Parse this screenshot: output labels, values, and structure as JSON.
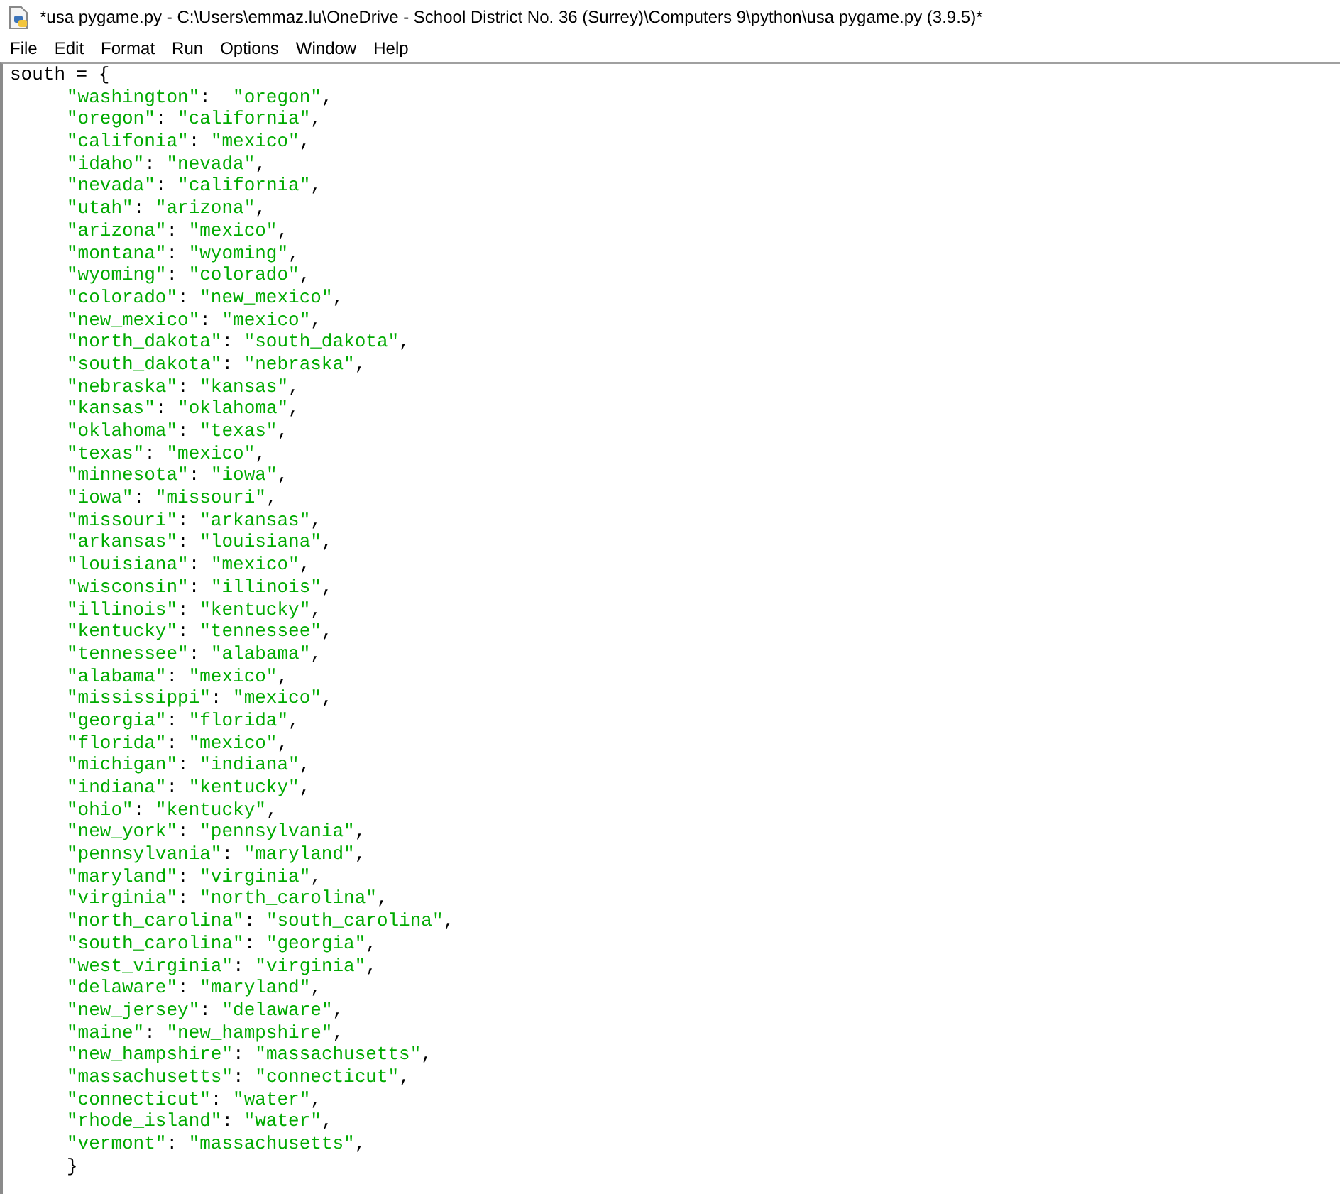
{
  "window": {
    "title": "*usa pygame.py - C:\\Users\\emmaz.lu\\OneDrive - School District No. 36 (Surrey)\\Computers 9\\python\\usa pygame.py (3.9.5)*"
  },
  "menu": [
    "File",
    "Edit",
    "Format",
    "Run",
    "Options",
    "Window",
    "Help"
  ],
  "editor": {
    "lines": [
      {
        "kind": "top",
        "segs": [
          {
            "t": "south = {",
            "kind": "plain"
          }
        ]
      },
      {
        "kind": "entry",
        "segs": [
          {
            "t": "\"washington\"",
            "kind": "string"
          },
          {
            "t": ":  ",
            "kind": "plain"
          },
          {
            "t": "\"oregon\"",
            "kind": "string"
          },
          {
            "t": ",",
            "kind": "plain"
          }
        ]
      },
      {
        "kind": "entry",
        "segs": [
          {
            "t": "\"oregon\"",
            "kind": "string"
          },
          {
            "t": ": ",
            "kind": "plain"
          },
          {
            "t": "\"california\"",
            "kind": "string"
          },
          {
            "t": ",",
            "kind": "plain"
          }
        ]
      },
      {
        "kind": "entry",
        "segs": [
          {
            "t": "\"califonia\"",
            "kind": "string"
          },
          {
            "t": ": ",
            "kind": "plain"
          },
          {
            "t": "\"mexico\"",
            "kind": "string"
          },
          {
            "t": ",",
            "kind": "plain"
          }
        ]
      },
      {
        "kind": "entry",
        "segs": [
          {
            "t": "\"idaho\"",
            "kind": "string"
          },
          {
            "t": ": ",
            "kind": "plain"
          },
          {
            "t": "\"nevada\"",
            "kind": "string"
          },
          {
            "t": ",",
            "kind": "plain"
          }
        ]
      },
      {
        "kind": "entry",
        "segs": [
          {
            "t": "\"nevada\"",
            "kind": "string"
          },
          {
            "t": ": ",
            "kind": "plain"
          },
          {
            "t": "\"california\"",
            "kind": "string"
          },
          {
            "t": ",",
            "kind": "plain"
          }
        ]
      },
      {
        "kind": "entry",
        "segs": [
          {
            "t": "\"utah\"",
            "kind": "string"
          },
          {
            "t": ": ",
            "kind": "plain"
          },
          {
            "t": "\"arizona\"",
            "kind": "string"
          },
          {
            "t": ",",
            "kind": "plain"
          }
        ]
      },
      {
        "kind": "entry",
        "segs": [
          {
            "t": "\"arizona\"",
            "kind": "string"
          },
          {
            "t": ": ",
            "kind": "plain"
          },
          {
            "t": "\"mexico\"",
            "kind": "string"
          },
          {
            "t": ",",
            "kind": "plain"
          }
        ]
      },
      {
        "kind": "entry",
        "segs": [
          {
            "t": "\"montana\"",
            "kind": "string"
          },
          {
            "t": ": ",
            "kind": "plain"
          },
          {
            "t": "\"wyoming\"",
            "kind": "string"
          },
          {
            "t": ",",
            "kind": "plain"
          }
        ]
      },
      {
        "kind": "entry",
        "segs": [
          {
            "t": "\"wyoming\"",
            "kind": "string"
          },
          {
            "t": ": ",
            "kind": "plain"
          },
          {
            "t": "\"colorado\"",
            "kind": "string"
          },
          {
            "t": ",",
            "kind": "plain"
          }
        ]
      },
      {
        "kind": "entry",
        "segs": [
          {
            "t": "\"colorado\"",
            "kind": "string"
          },
          {
            "t": ": ",
            "kind": "plain"
          },
          {
            "t": "\"new_mexico\"",
            "kind": "string"
          },
          {
            "t": ",",
            "kind": "plain"
          }
        ]
      },
      {
        "kind": "entry",
        "segs": [
          {
            "t": "\"new_mexico\"",
            "kind": "string"
          },
          {
            "t": ": ",
            "kind": "plain"
          },
          {
            "t": "\"mexico\"",
            "kind": "string"
          },
          {
            "t": ",",
            "kind": "plain"
          }
        ]
      },
      {
        "kind": "entry",
        "segs": [
          {
            "t": "\"north_dakota\"",
            "kind": "string"
          },
          {
            "t": ": ",
            "kind": "plain"
          },
          {
            "t": "\"south_dakota\"",
            "kind": "string"
          },
          {
            "t": ",",
            "kind": "plain"
          }
        ]
      },
      {
        "kind": "entry",
        "segs": [
          {
            "t": "\"south_dakota\"",
            "kind": "string"
          },
          {
            "t": ": ",
            "kind": "plain"
          },
          {
            "t": "\"nebraska\"",
            "kind": "string"
          },
          {
            "t": ",",
            "kind": "plain"
          }
        ]
      },
      {
        "kind": "entry",
        "segs": [
          {
            "t": "\"nebraska\"",
            "kind": "string"
          },
          {
            "t": ": ",
            "kind": "plain"
          },
          {
            "t": "\"kansas\"",
            "kind": "string"
          },
          {
            "t": ",",
            "kind": "plain"
          }
        ]
      },
      {
        "kind": "entry",
        "segs": [
          {
            "t": "\"kansas\"",
            "kind": "string"
          },
          {
            "t": ": ",
            "kind": "plain"
          },
          {
            "t": "\"oklahoma\"",
            "kind": "string"
          },
          {
            "t": ",",
            "kind": "plain"
          }
        ]
      },
      {
        "kind": "entry",
        "segs": [
          {
            "t": "\"oklahoma\"",
            "kind": "string"
          },
          {
            "t": ": ",
            "kind": "plain"
          },
          {
            "t": "\"texas\"",
            "kind": "string"
          },
          {
            "t": ",",
            "kind": "plain"
          }
        ]
      },
      {
        "kind": "entry",
        "segs": [
          {
            "t": "\"texas\"",
            "kind": "string"
          },
          {
            "t": ": ",
            "kind": "plain"
          },
          {
            "t": "\"mexico\"",
            "kind": "string"
          },
          {
            "t": ",",
            "kind": "plain"
          }
        ]
      },
      {
        "kind": "entry",
        "segs": [
          {
            "t": "\"minnesota\"",
            "kind": "string"
          },
          {
            "t": ": ",
            "kind": "plain"
          },
          {
            "t": "\"iowa\"",
            "kind": "string"
          },
          {
            "t": ",",
            "kind": "plain"
          }
        ]
      },
      {
        "kind": "entry",
        "segs": [
          {
            "t": "\"iowa\"",
            "kind": "string"
          },
          {
            "t": ": ",
            "kind": "plain"
          },
          {
            "t": "\"missouri\"",
            "kind": "string"
          },
          {
            "t": ",",
            "kind": "plain"
          }
        ]
      },
      {
        "kind": "entry",
        "segs": [
          {
            "t": "\"missouri\"",
            "kind": "string"
          },
          {
            "t": ": ",
            "kind": "plain"
          },
          {
            "t": "\"arkansas\"",
            "kind": "string"
          },
          {
            "t": ",",
            "kind": "plain"
          }
        ]
      },
      {
        "kind": "entry",
        "segs": [
          {
            "t": "\"arkansas\"",
            "kind": "string"
          },
          {
            "t": ": ",
            "kind": "plain"
          },
          {
            "t": "\"louisiana\"",
            "kind": "string"
          },
          {
            "t": ",",
            "kind": "plain"
          }
        ]
      },
      {
        "kind": "entry",
        "segs": [
          {
            "t": "\"louisiana\"",
            "kind": "string"
          },
          {
            "t": ": ",
            "kind": "plain"
          },
          {
            "t": "\"mexico\"",
            "kind": "string"
          },
          {
            "t": ",",
            "kind": "plain"
          }
        ]
      },
      {
        "kind": "entry",
        "segs": [
          {
            "t": "\"wisconsin\"",
            "kind": "string"
          },
          {
            "t": ": ",
            "kind": "plain"
          },
          {
            "t": "\"illinois\"",
            "kind": "string"
          },
          {
            "t": ",",
            "kind": "plain"
          }
        ]
      },
      {
        "kind": "entry",
        "segs": [
          {
            "t": "\"illinois\"",
            "kind": "string"
          },
          {
            "t": ": ",
            "kind": "plain"
          },
          {
            "t": "\"kentucky\"",
            "kind": "string"
          },
          {
            "t": ",",
            "kind": "plain"
          }
        ]
      },
      {
        "kind": "entry",
        "segs": [
          {
            "t": "\"kentucky\"",
            "kind": "string"
          },
          {
            "t": ": ",
            "kind": "plain"
          },
          {
            "t": "\"tennessee\"",
            "kind": "string"
          },
          {
            "t": ",",
            "kind": "plain"
          }
        ]
      },
      {
        "kind": "entry",
        "segs": [
          {
            "t": "\"tennessee\"",
            "kind": "string"
          },
          {
            "t": ": ",
            "kind": "plain"
          },
          {
            "t": "\"alabama\"",
            "kind": "string"
          },
          {
            "t": ",",
            "kind": "plain"
          }
        ]
      },
      {
        "kind": "entry",
        "segs": [
          {
            "t": "\"alabama\"",
            "kind": "string"
          },
          {
            "t": ": ",
            "kind": "plain"
          },
          {
            "t": "\"mexico\"",
            "kind": "string"
          },
          {
            "t": ",",
            "kind": "plain"
          }
        ]
      },
      {
        "kind": "entry",
        "segs": [
          {
            "t": "\"mississippi\"",
            "kind": "string"
          },
          {
            "t": ": ",
            "kind": "plain"
          },
          {
            "t": "\"mexico\"",
            "kind": "string"
          },
          {
            "t": ",",
            "kind": "plain"
          }
        ]
      },
      {
        "kind": "entry",
        "segs": [
          {
            "t": "\"georgia\"",
            "kind": "string"
          },
          {
            "t": ": ",
            "kind": "plain"
          },
          {
            "t": "\"florida\"",
            "kind": "string"
          },
          {
            "t": ",",
            "kind": "plain"
          }
        ]
      },
      {
        "kind": "entry",
        "segs": [
          {
            "t": "\"florida\"",
            "kind": "string"
          },
          {
            "t": ": ",
            "kind": "plain"
          },
          {
            "t": "\"mexico\"",
            "kind": "string"
          },
          {
            "t": ",",
            "kind": "plain"
          }
        ]
      },
      {
        "kind": "entry",
        "segs": [
          {
            "t": "\"michigan\"",
            "kind": "string"
          },
          {
            "t": ": ",
            "kind": "plain"
          },
          {
            "t": "\"indiana\"",
            "kind": "string"
          },
          {
            "t": ",",
            "kind": "plain"
          }
        ]
      },
      {
        "kind": "entry",
        "segs": [
          {
            "t": "\"indiana\"",
            "kind": "string"
          },
          {
            "t": ": ",
            "kind": "plain"
          },
          {
            "t": "\"kentucky\"",
            "kind": "string"
          },
          {
            "t": ",",
            "kind": "plain"
          }
        ]
      },
      {
        "kind": "entry",
        "segs": [
          {
            "t": "\"ohio\"",
            "kind": "string"
          },
          {
            "t": ": ",
            "kind": "plain"
          },
          {
            "t": "\"kentucky\"",
            "kind": "string"
          },
          {
            "t": ",",
            "kind": "plain"
          }
        ]
      },
      {
        "kind": "entry",
        "segs": [
          {
            "t": "\"new_york\"",
            "kind": "string"
          },
          {
            "t": ": ",
            "kind": "plain"
          },
          {
            "t": "\"pennsylvania\"",
            "kind": "string"
          },
          {
            "t": ",",
            "kind": "plain"
          }
        ]
      },
      {
        "kind": "entry",
        "segs": [
          {
            "t": "\"pennsylvania\"",
            "kind": "string"
          },
          {
            "t": ": ",
            "kind": "plain"
          },
          {
            "t": "\"maryland\"",
            "kind": "string"
          },
          {
            "t": ",",
            "kind": "plain"
          }
        ]
      },
      {
        "kind": "entry",
        "segs": [
          {
            "t": "\"maryland\"",
            "kind": "string"
          },
          {
            "t": ": ",
            "kind": "plain"
          },
          {
            "t": "\"virginia\"",
            "kind": "string"
          },
          {
            "t": ",",
            "kind": "plain"
          }
        ]
      },
      {
        "kind": "entry",
        "segs": [
          {
            "t": "\"virginia\"",
            "kind": "string"
          },
          {
            "t": ": ",
            "kind": "plain"
          },
          {
            "t": "\"north_carolina\"",
            "kind": "string"
          },
          {
            "t": ",",
            "kind": "plain"
          }
        ]
      },
      {
        "kind": "entry",
        "segs": [
          {
            "t": "\"north_carolina\"",
            "kind": "string"
          },
          {
            "t": ": ",
            "kind": "plain"
          },
          {
            "t": "\"south_carolina\"",
            "kind": "string"
          },
          {
            "t": ",",
            "kind": "plain"
          }
        ]
      },
      {
        "kind": "entry",
        "segs": [
          {
            "t": "\"south_carolina\"",
            "kind": "string"
          },
          {
            "t": ": ",
            "kind": "plain"
          },
          {
            "t": "\"georgia\"",
            "kind": "string"
          },
          {
            "t": ",",
            "kind": "plain"
          }
        ]
      },
      {
        "kind": "entry",
        "segs": [
          {
            "t": "\"west_virginia\"",
            "kind": "string"
          },
          {
            "t": ": ",
            "kind": "plain"
          },
          {
            "t": "\"virginia\"",
            "kind": "string"
          },
          {
            "t": ",",
            "kind": "plain"
          }
        ]
      },
      {
        "kind": "entry",
        "segs": [
          {
            "t": "\"delaware\"",
            "kind": "string"
          },
          {
            "t": ": ",
            "kind": "plain"
          },
          {
            "t": "\"maryland\"",
            "kind": "string"
          },
          {
            "t": ",",
            "kind": "plain"
          }
        ]
      },
      {
        "kind": "entry",
        "segs": [
          {
            "t": "\"new_jersey\"",
            "kind": "string"
          },
          {
            "t": ": ",
            "kind": "plain"
          },
          {
            "t": "\"delaware\"",
            "kind": "string"
          },
          {
            "t": ",",
            "kind": "plain"
          }
        ]
      },
      {
        "kind": "entry",
        "segs": [
          {
            "t": "\"maine\"",
            "kind": "string"
          },
          {
            "t": ": ",
            "kind": "plain"
          },
          {
            "t": "\"new_hampshire\"",
            "kind": "string"
          },
          {
            "t": ",",
            "kind": "plain"
          }
        ]
      },
      {
        "kind": "entry",
        "segs": [
          {
            "t": "\"new_hampshire\"",
            "kind": "string"
          },
          {
            "t": ": ",
            "kind": "plain"
          },
          {
            "t": "\"massachusetts\"",
            "kind": "string"
          },
          {
            "t": ",",
            "kind": "plain"
          }
        ]
      },
      {
        "kind": "entry",
        "segs": [
          {
            "t": "\"massachusetts\"",
            "kind": "string"
          },
          {
            "t": ": ",
            "kind": "plain"
          },
          {
            "t": "\"connecticut\"",
            "kind": "string"
          },
          {
            "t": ",",
            "kind": "plain"
          }
        ]
      },
      {
        "kind": "entry",
        "segs": [
          {
            "t": "\"connecticut\"",
            "kind": "string"
          },
          {
            "t": ": ",
            "kind": "plain"
          },
          {
            "t": "\"water\"",
            "kind": "string"
          },
          {
            "t": ",",
            "kind": "plain"
          }
        ]
      },
      {
        "kind": "entry",
        "segs": [
          {
            "t": "\"rhode_island\"",
            "kind": "string"
          },
          {
            "t": ": ",
            "kind": "plain"
          },
          {
            "t": "\"water\"",
            "kind": "string"
          },
          {
            "t": ",",
            "kind": "plain"
          }
        ]
      },
      {
        "kind": "entry",
        "segs": [
          {
            "t": "\"vermont\"",
            "kind": "string"
          },
          {
            "t": ": ",
            "kind": "plain"
          },
          {
            "t": "\"massachusetts\"",
            "kind": "string"
          },
          {
            "t": ",",
            "kind": "plain"
          }
        ]
      },
      {
        "kind": "entry",
        "segs": [
          {
            "t": "}",
            "kind": "plain"
          }
        ]
      }
    ]
  }
}
